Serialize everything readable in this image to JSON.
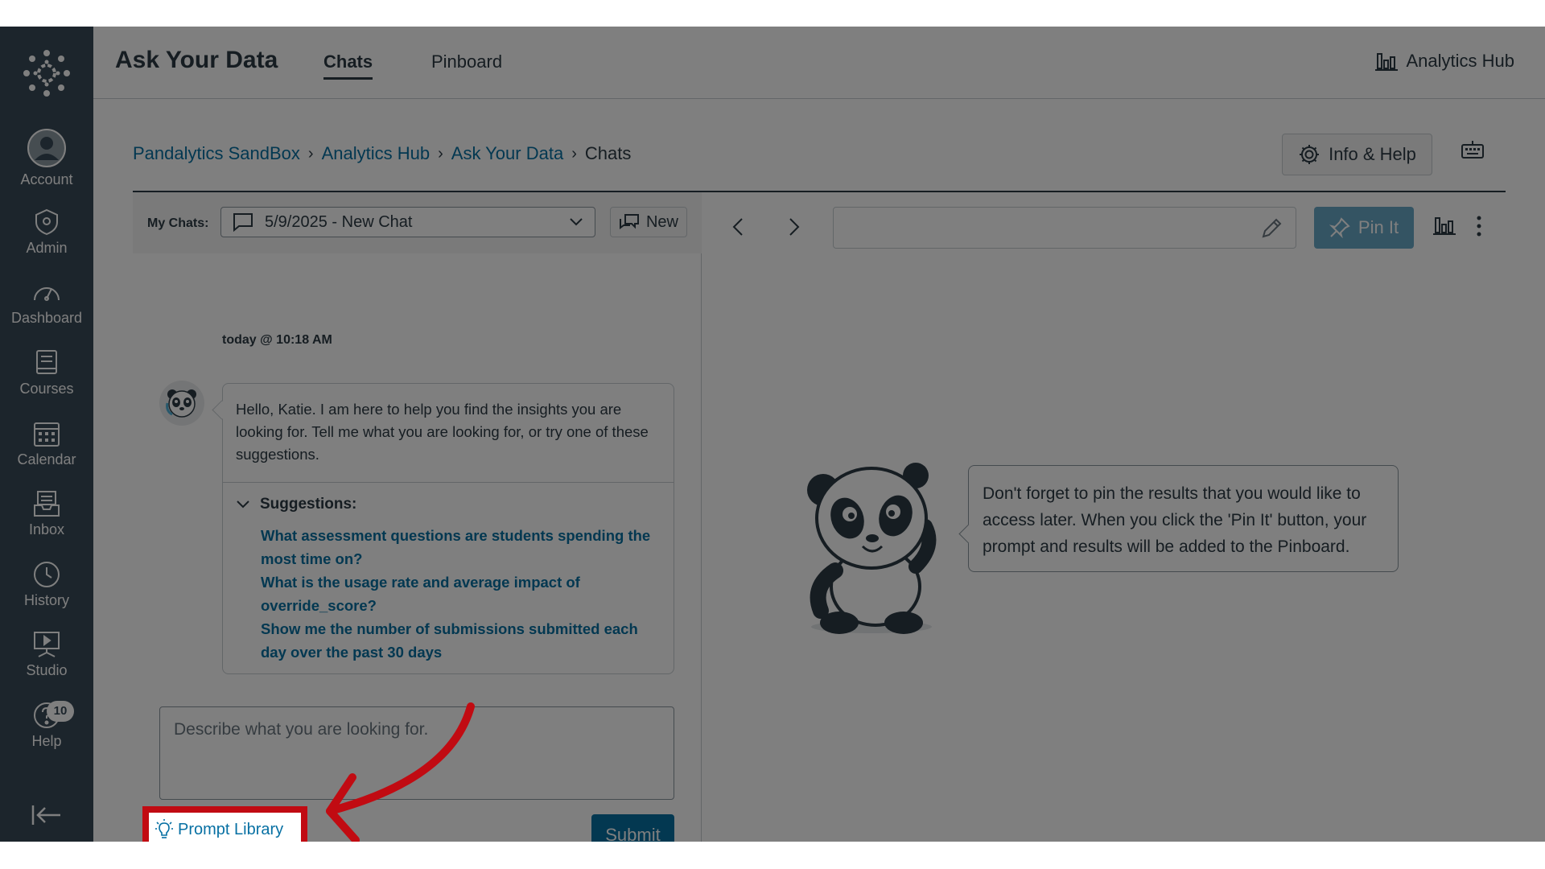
{
  "global_nav": {
    "items": [
      {
        "label": "Account",
        "icon": "user-avatar-icon"
      },
      {
        "label": "Admin",
        "icon": "shield-icon"
      },
      {
        "label": "Dashboard",
        "icon": "gauge-icon"
      },
      {
        "label": "Courses",
        "icon": "book-icon"
      },
      {
        "label": "Calendar",
        "icon": "calendar-icon"
      },
      {
        "label": "Inbox",
        "icon": "inbox-icon"
      },
      {
        "label": "History",
        "icon": "clock-icon"
      },
      {
        "label": "Studio",
        "icon": "studio-icon"
      },
      {
        "label": "Help",
        "icon": "help-icon",
        "badge": "10"
      }
    ]
  },
  "header": {
    "title": "Ask Your Data",
    "tabs": [
      {
        "label": "Chats",
        "active": true
      },
      {
        "label": "Pinboard",
        "active": false
      }
    ],
    "hub_link": "Analytics Hub"
  },
  "breadcrumb": {
    "items": [
      "Pandalytics SandBox",
      "Analytics Hub",
      "Ask Your Data"
    ],
    "current": "Chats"
  },
  "info_help_label": "Info & Help",
  "left_panel": {
    "my_chats_label": "My Chats:",
    "selected_chat": "5/9/2025 - New Chat",
    "new_label": "New",
    "message": {
      "time": "today @ 10:18 AM",
      "text": "Hello, Katie. I am here to help you find the insights you are looking for. Tell me what you are looking for, or try one of these suggestions.",
      "suggestions_label": "Suggestions:",
      "suggestions": [
        "What assessment questions are students spending the most time on?",
        "What is the usage rate and average impact of override_score?",
        "Show me the number of submissions submitted each day over the past 30 days"
      ]
    },
    "prompt_placeholder": "Describe what you are looking for.",
    "prompt_library_label": "Prompt Library",
    "submit_label": "Submit"
  },
  "right_panel": {
    "pin_label": "Pin It",
    "tip": "Don't forget to pin the results that you would like to access later. When you click the 'Pin It' button, your prompt and results will be added to the Pinboard."
  },
  "colors": {
    "nav_bg": "#394b58",
    "link": "#0770a3",
    "primary_button": "#0770a3",
    "highlight": "#c10b12"
  }
}
